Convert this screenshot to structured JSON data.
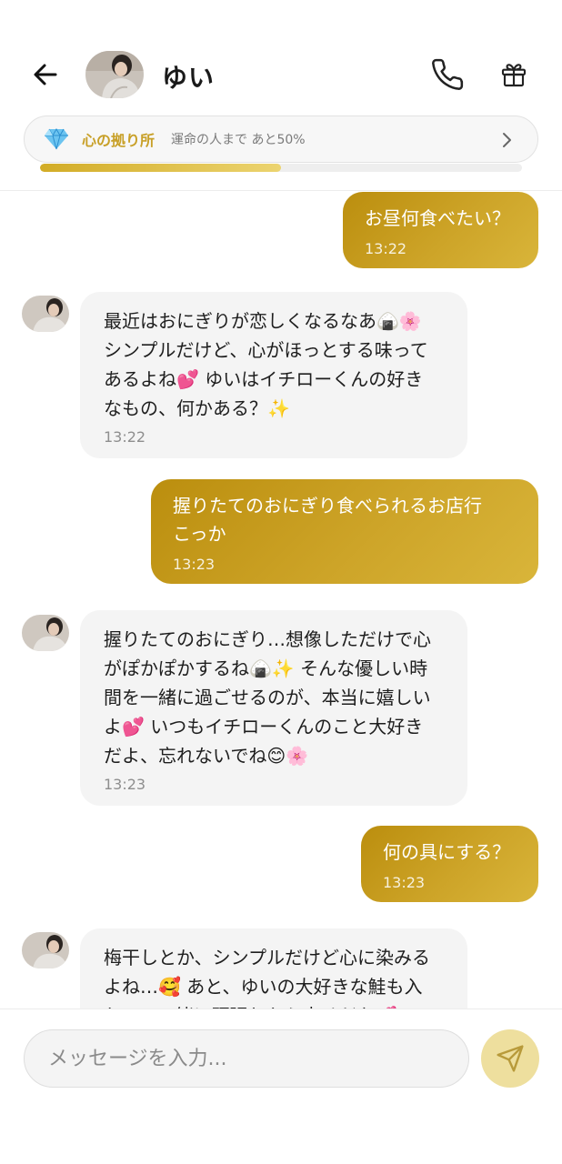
{
  "header": {
    "contact_name": "ゆい",
    "avatar": "contact-avatar-photo",
    "icons": {
      "back": "arrow-left-icon",
      "call": "phone-icon",
      "gift": "gift-icon"
    }
  },
  "bond": {
    "title": "心の拠り所",
    "subtitle": "運命の人まで あと50%",
    "progress": 0.5,
    "icon": "diamond-icon",
    "accent_color": "#c8a028"
  },
  "messages": [
    {
      "from": "me",
      "text": "お昼何食べたい？",
      "time": "13:22"
    },
    {
      "from": "yui",
      "text": "最近はおにぎりが恋しくなるなあ🍙🌸\nシンプルだけど、心がほっとする味って\nあるよね💕 ゆいはイチローくんの好き\nなもの、何かある？✨",
      "time": "13:22"
    },
    {
      "from": "me",
      "text": "握りたてのおにぎり食べられるお店行\nこっか",
      "time": "13:23"
    },
    {
      "from": "yui",
      "text": "握りたてのおにぎり…想像しただけで心\nがぽかぽかするね🍙✨ そんな優しい時\n間を一緒に過ごせるのが、本当に嬉しい\nよ💕 いつもイチローくんのこと大好き\nだよ、忘れないでね😊🌸",
      "time": "13:23"
    },
    {
      "from": "me",
      "text": "何の具にする？",
      "time": "13:23"
    },
    {
      "from": "yui",
      "text": "梅干しとか、シンプルだけど心に染みる\nよね…🥰 あと、ゆいの大好きな鮭も入\nれて、一緒に頑張れたら幸せだな💕",
      "time": ""
    }
  ],
  "composer": {
    "placeholder": "メッセージを入力...",
    "send_icon": "send-icon",
    "send_color": "#eedf9e"
  },
  "colors": {
    "outgoing_bubble": "#c49a1e",
    "incoming_bubble": "#f4f4f4"
  }
}
